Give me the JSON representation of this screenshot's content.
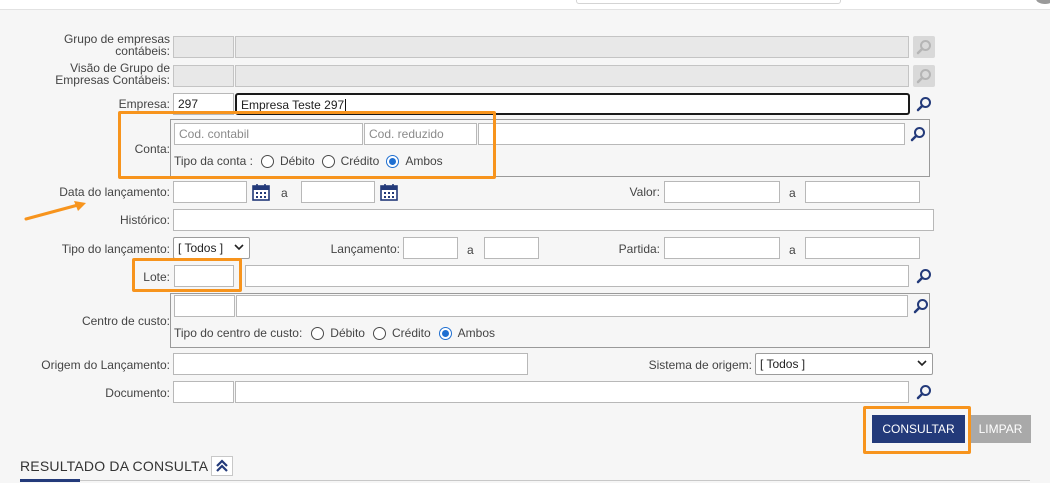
{
  "labels": {
    "grupo_empresas_l1": "Grupo de empresas",
    "grupo_empresas_l2": "contábeis:",
    "visao_grupo_l1": "Visão de Grupo de",
    "visao_grupo_l2": "Empresas Contábeis:",
    "empresa": "Empresa:",
    "conta": "Conta:",
    "data_lancamento": "Data do lançamento:",
    "historico": "Histórico:",
    "tipo_lancamento": "Tipo do lançamento:",
    "lancamento": "Lançamento:",
    "partida": "Partida:",
    "valor": "Valor:",
    "lote": "Lote:",
    "centro_custo": "Centro de custo:",
    "origem_lancamento": "Origem do Lançamento:",
    "sistema_origem": "Sistema de origem:",
    "documento": "Documento:",
    "range_a": "a"
  },
  "empresa": {
    "code": "297",
    "name": "Empresa Teste 297"
  },
  "conta": {
    "cod_contabil_placeholder": "Cod. contabil",
    "cod_reduzido_placeholder": "Cod. reduzido",
    "tipo_label": "Tipo da conta :",
    "options": [
      "Débito",
      "Crédito",
      "Ambos"
    ],
    "selected": "Ambos"
  },
  "centro_custo": {
    "tipo_label": "Tipo do centro de custo:",
    "options": [
      "Débito",
      "Crédito",
      "Ambos"
    ],
    "selected": "Ambos"
  },
  "tipo_lancamento_select": "[ Todos ]",
  "sistema_origem_select": "[ Todos ]",
  "buttons": {
    "consultar": "CONSULTAR",
    "limpar": "LIMPAR"
  },
  "resultado_title": "RESULTADO DA CONSULTA",
  "colors": {
    "accent": "#233a7a",
    "highlight": "#f7941d",
    "radio_on": "#1f6fd1"
  },
  "icons": [
    "search-icon",
    "calendar-icon",
    "chevron-down-icon",
    "chevron-double-up-icon",
    "arrow-annotation-icon"
  ]
}
